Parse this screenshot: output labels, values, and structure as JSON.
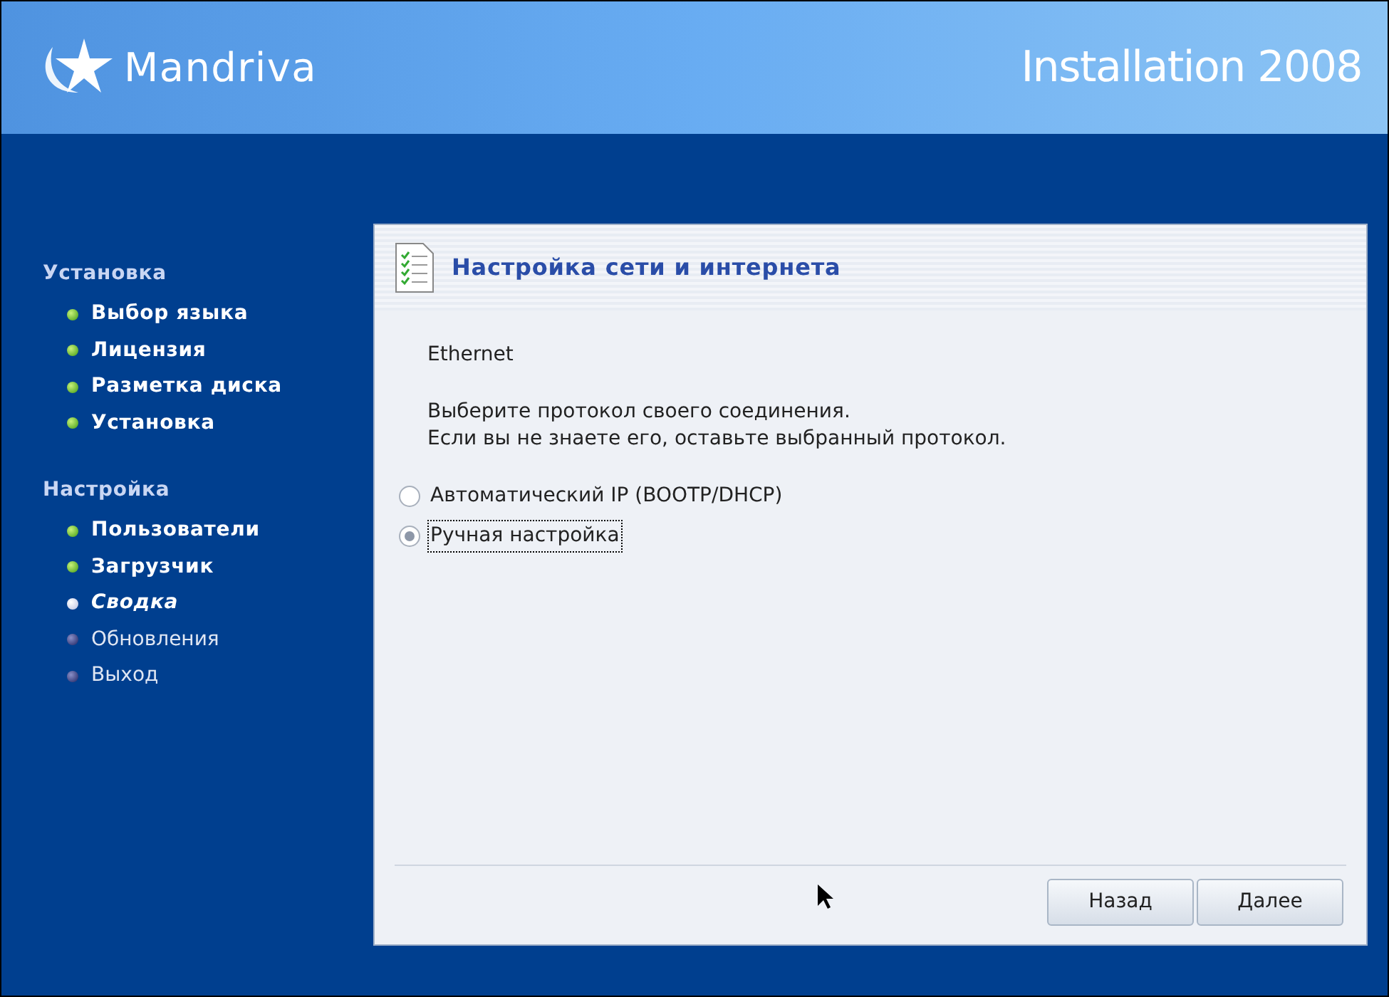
{
  "header": {
    "brand": "Mandriva",
    "title": "Installation 2008"
  },
  "sidebar": {
    "sections": [
      {
        "title": "Установка",
        "items": [
          {
            "label": "Выбор языка",
            "kind": "done"
          },
          {
            "label": "Лицензия",
            "kind": "done"
          },
          {
            "label": "Разметка диска",
            "kind": "done"
          },
          {
            "label": "Установка",
            "kind": "done"
          }
        ]
      },
      {
        "title": "Настройка",
        "items": [
          {
            "label": "Пользователи",
            "kind": "done"
          },
          {
            "label": "Загрузчик",
            "kind": "done"
          },
          {
            "label": "Сводка",
            "kind": "current"
          },
          {
            "label": "Обновления",
            "kind": "pending"
          },
          {
            "label": "Выход",
            "kind": "pending"
          }
        ]
      }
    ]
  },
  "dialog": {
    "title": "Настройка сети и интернета",
    "device": "Ethernet",
    "instructions": [
      "Выберите протокол своего соединения.",
      "Если вы не знаете его, оставьте выбранный протокол."
    ],
    "options": [
      {
        "label": "Автоматический IP (BOOTP/DHCP)",
        "selected": false
      },
      {
        "label": "Ручная настройка",
        "selected": true
      }
    ],
    "buttons": [
      "Назад",
      "Далее"
    ]
  }
}
